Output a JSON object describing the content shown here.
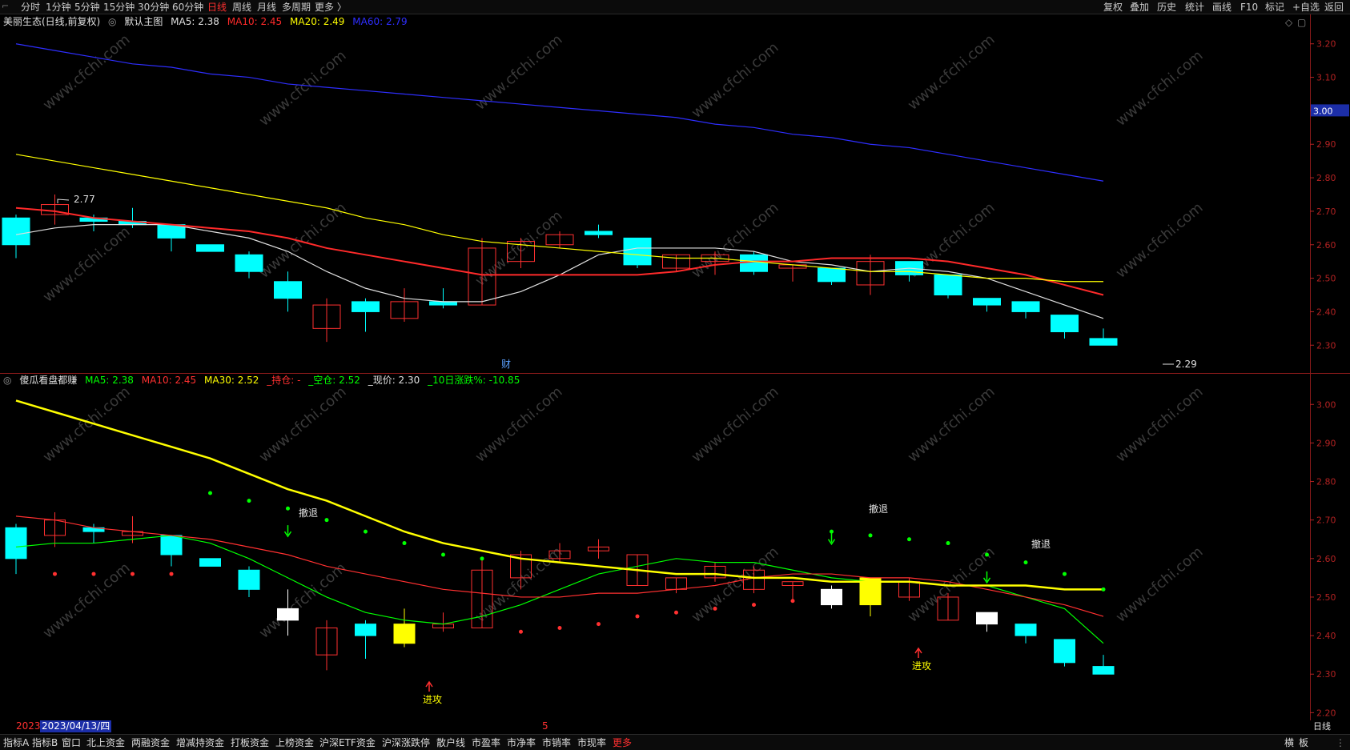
{
  "toolbar": {
    "periods": [
      "分时",
      "1分钟",
      "5分钟",
      "15分钟",
      "30分钟",
      "60分钟",
      "日线",
      "周线",
      "月线",
      "多周期",
      "更多 〉"
    ],
    "active_period": "日线",
    "right_buttons": [
      "复权",
      "叠加",
      "历史",
      "统计",
      "画线",
      "F10",
      "标记",
      "+自选",
      "返回"
    ]
  },
  "main_panel": {
    "stock_title": "美丽生态(日线,前复权)",
    "template": "默认主图",
    "ma": [
      {
        "label": "MA5: 2.38",
        "color": "#e0e0e0"
      },
      {
        "label": "MA10: 2.45",
        "color": "#ff2a2a"
      },
      {
        "label": "MA20: 2.49",
        "color": "#ffff00"
      },
      {
        "label": "MA60: 2.79",
        "color": "#2e2eff"
      }
    ],
    "high_label": "2.77",
    "low_label": "2.29",
    "finance_marker": "财",
    "current_price": "3.00",
    "axis_ticks": [
      "3.20",
      "3.10",
      "3.00",
      "2.90",
      "2.80",
      "2.70",
      "2.60",
      "2.50",
      "2.40",
      "2.30"
    ]
  },
  "sub_panel": {
    "indicator_name": "傻瓜看盘都赚",
    "values": [
      {
        "label": "MA5: 2.38",
        "color": "#00ff00"
      },
      {
        "label": "MA10: 2.45",
        "color": "#ff3030"
      },
      {
        "label": "MA30: 2.52",
        "color": "#ffff00"
      },
      {
        "label": "_持仓: -",
        "color": "#ff3030"
      },
      {
        "label": "_空仓: 2.52",
        "color": "#00ff00"
      },
      {
        "label": "_现价: 2.30",
        "color": "#e0e0e0"
      },
      {
        "label": "_10日涨跌%: -10.85",
        "color": "#00ff00"
      }
    ],
    "signals": {
      "retreat": "撤退",
      "attack": "进攻"
    },
    "axis_ticks": [
      "3.00",
      "2.90",
      "2.80",
      "2.70",
      "2.60",
      "2.50",
      "2.40",
      "2.30",
      "2.20"
    ]
  },
  "date_strip": {
    "year": "2023",
    "cursor_date": "2023/04/13/四",
    "month_mark": "5",
    "axis_mode": "日线"
  },
  "bottom_tabs": [
    "指标A",
    "指标B",
    "窗口",
    "北上资金",
    "两融资金",
    "增减持资金",
    "打板资金",
    "上榜资金",
    "沪深ETF资金",
    "沪深涨跌停",
    "散户线",
    "市盈率",
    "市净率",
    "市销率",
    "市现率",
    "更多"
  ],
  "bottom_right": [
    "横",
    "板"
  ],
  "watermark": "www.cfchi.com",
  "colors": {
    "up": "#ff3030",
    "down": "#00ffff",
    "ma60": "#2e2eff",
    "ma20": "#ffff00",
    "ma10": "#ff2a2a",
    "ma5": "#e0e0e0",
    "active": "#ff3030",
    "axis": "#b22222"
  },
  "chart_data": [
    {
      "type": "candlestick",
      "title": "美丽生态(日线,前复权)",
      "ohlc": [
        [
          2.68,
          2.69,
          2.56,
          2.6
        ],
        [
          2.69,
          2.75,
          2.66,
          2.72
        ],
        [
          2.68,
          2.69,
          2.64,
          2.67
        ],
        [
          2.67,
          2.71,
          2.65,
          2.66
        ],
        [
          2.66,
          2.66,
          2.58,
          2.62
        ],
        [
          2.6,
          2.6,
          2.58,
          2.58
        ],
        [
          2.57,
          2.58,
          2.5,
          2.52
        ],
        [
          2.49,
          2.52,
          2.4,
          2.44
        ],
        [
          2.35,
          2.44,
          2.31,
          2.42
        ],
        [
          2.43,
          2.44,
          2.34,
          2.4
        ],
        [
          2.38,
          2.47,
          2.37,
          2.43
        ],
        [
          2.43,
          2.47,
          2.41,
          2.42
        ],
        [
          2.42,
          2.62,
          2.42,
          2.59
        ],
        [
          2.55,
          2.62,
          2.53,
          2.61
        ],
        [
          2.6,
          2.64,
          2.59,
          2.63
        ],
        [
          2.64,
          2.66,
          2.62,
          2.63
        ],
        [
          2.62,
          2.62,
          2.53,
          2.54
        ],
        [
          2.53,
          2.57,
          2.52,
          2.57
        ],
        [
          2.55,
          2.58,
          2.51,
          2.57
        ],
        [
          2.57,
          2.58,
          2.51,
          2.52
        ],
        [
          2.53,
          2.54,
          2.49,
          2.54
        ],
        [
          2.53,
          2.53,
          2.48,
          2.49
        ],
        [
          2.48,
          2.57,
          2.45,
          2.55
        ],
        [
          2.55,
          2.55,
          2.49,
          2.51
        ],
        [
          2.51,
          2.51,
          2.44,
          2.45
        ],
        [
          2.44,
          2.44,
          2.4,
          2.42
        ],
        [
          2.43,
          2.43,
          2.38,
          2.4
        ],
        [
          2.39,
          2.39,
          2.32,
          2.34
        ],
        [
          2.32,
          2.35,
          2.3,
          2.3
        ]
      ],
      "series": [
        {
          "name": "MA5",
          "values": [
            2.63,
            2.65,
            2.66,
            2.66,
            2.66,
            2.64,
            2.62,
            2.58,
            2.52,
            2.47,
            2.44,
            2.43,
            2.43,
            2.46,
            2.51,
            2.57,
            2.59,
            2.59,
            2.59,
            2.58,
            2.55,
            2.54,
            2.52,
            2.53,
            2.52,
            2.5,
            2.46,
            2.42,
            2.38
          ]
        },
        {
          "name": "MA10",
          "values": [
            2.71,
            2.7,
            2.68,
            2.67,
            2.66,
            2.65,
            2.64,
            2.62,
            2.59,
            2.57,
            2.55,
            2.53,
            2.51,
            2.51,
            2.51,
            2.51,
            2.51,
            2.52,
            2.54,
            2.55,
            2.55,
            2.56,
            2.56,
            2.56,
            2.55,
            2.53,
            2.51,
            2.48,
            2.45
          ]
        },
        {
          "name": "MA20",
          "values": [
            2.87,
            2.85,
            2.83,
            2.81,
            2.79,
            2.77,
            2.75,
            2.73,
            2.71,
            2.68,
            2.66,
            2.63,
            2.61,
            2.6,
            2.59,
            2.58,
            2.57,
            2.56,
            2.56,
            2.55,
            2.54,
            2.53,
            2.52,
            2.52,
            2.51,
            2.5,
            2.5,
            2.49,
            2.49
          ]
        },
        {
          "name": "MA60",
          "values": [
            3.2,
            3.18,
            3.16,
            3.14,
            3.13,
            3.11,
            3.1,
            3.08,
            3.07,
            3.06,
            3.05,
            3.04,
            3.03,
            3.02,
            3.01,
            3.0,
            2.99,
            2.98,
            2.96,
            2.95,
            2.93,
            2.92,
            2.9,
            2.89,
            2.87,
            2.85,
            2.83,
            2.81,
            2.79
          ]
        }
      ],
      "ylim": [
        2.26,
        3.24
      ]
    },
    {
      "type": "candlestick",
      "title": "傻瓜看盘都赚",
      "ohlc": [
        [
          2.68,
          2.69,
          2.56,
          2.6
        ],
        [
          2.66,
          2.72,
          2.63,
          2.7
        ],
        [
          2.68,
          2.69,
          2.64,
          2.67
        ],
        [
          2.66,
          2.71,
          2.64,
          2.67
        ],
        [
          2.66,
          2.66,
          2.58,
          2.61
        ],
        [
          2.6,
          2.6,
          2.58,
          2.58
        ],
        [
          2.57,
          2.58,
          2.5,
          2.52
        ],
        [
          2.47,
          2.52,
          2.4,
          2.44
        ],
        [
          2.35,
          2.44,
          2.31,
          2.42
        ],
        [
          2.43,
          2.44,
          2.34,
          2.4
        ],
        [
          2.38,
          2.47,
          2.37,
          2.43
        ],
        [
          2.42,
          2.46,
          2.41,
          2.43
        ],
        [
          2.42,
          2.6,
          2.42,
          2.57
        ],
        [
          2.55,
          2.62,
          2.52,
          2.61
        ],
        [
          2.6,
          2.64,
          2.59,
          2.62
        ],
        [
          2.62,
          2.65,
          2.6,
          2.63
        ],
        [
          2.53,
          2.61,
          2.53,
          2.61
        ],
        [
          2.52,
          2.55,
          2.51,
          2.55
        ],
        [
          2.55,
          2.59,
          2.54,
          2.58
        ],
        [
          2.52,
          2.58,
          2.51,
          2.57
        ],
        [
          2.53,
          2.54,
          2.49,
          2.54
        ],
        [
          2.48,
          2.53,
          2.47,
          2.52
        ],
        [
          2.48,
          2.55,
          2.45,
          2.55
        ],
        [
          2.5,
          2.55,
          2.49,
          2.54
        ],
        [
          2.44,
          2.51,
          2.44,
          2.5
        ],
        [
          2.43,
          2.43,
          2.41,
          2.46
        ],
        [
          2.43,
          2.43,
          2.38,
          2.4
        ],
        [
          2.39,
          2.39,
          2.32,
          2.33
        ],
        [
          2.32,
          2.35,
          2.3,
          2.3
        ]
      ],
      "series": [
        {
          "name": "MA5",
          "values": [
            2.63,
            2.64,
            2.64,
            2.65,
            2.66,
            2.64,
            2.6,
            2.55,
            2.5,
            2.46,
            2.44,
            2.43,
            2.45,
            2.48,
            2.52,
            2.56,
            2.58,
            2.6,
            2.59,
            2.59,
            2.57,
            2.55,
            2.54,
            2.54,
            2.53,
            2.53,
            2.5,
            2.47,
            2.38
          ]
        },
        {
          "name": "MA10",
          "values": [
            2.71,
            2.7,
            2.68,
            2.67,
            2.66,
            2.65,
            2.63,
            2.61,
            2.58,
            2.56,
            2.54,
            2.52,
            2.51,
            2.5,
            2.5,
            2.51,
            2.51,
            2.52,
            2.53,
            2.55,
            2.56,
            2.56,
            2.55,
            2.55,
            2.54,
            2.52,
            2.5,
            2.48,
            2.45
          ]
        },
        {
          "name": "MA30",
          "values": [
            3.01,
            2.98,
            2.95,
            2.92,
            2.89,
            2.86,
            2.82,
            2.78,
            2.75,
            2.71,
            2.67,
            2.64,
            2.62,
            2.6,
            2.59,
            2.58,
            2.57,
            2.56,
            2.56,
            2.55,
            2.55,
            2.54,
            2.54,
            2.54,
            2.53,
            2.53,
            2.53,
            2.52,
            2.52
          ]
        }
      ],
      "ylim": [
        2.18,
        3.04
      ]
    }
  ]
}
